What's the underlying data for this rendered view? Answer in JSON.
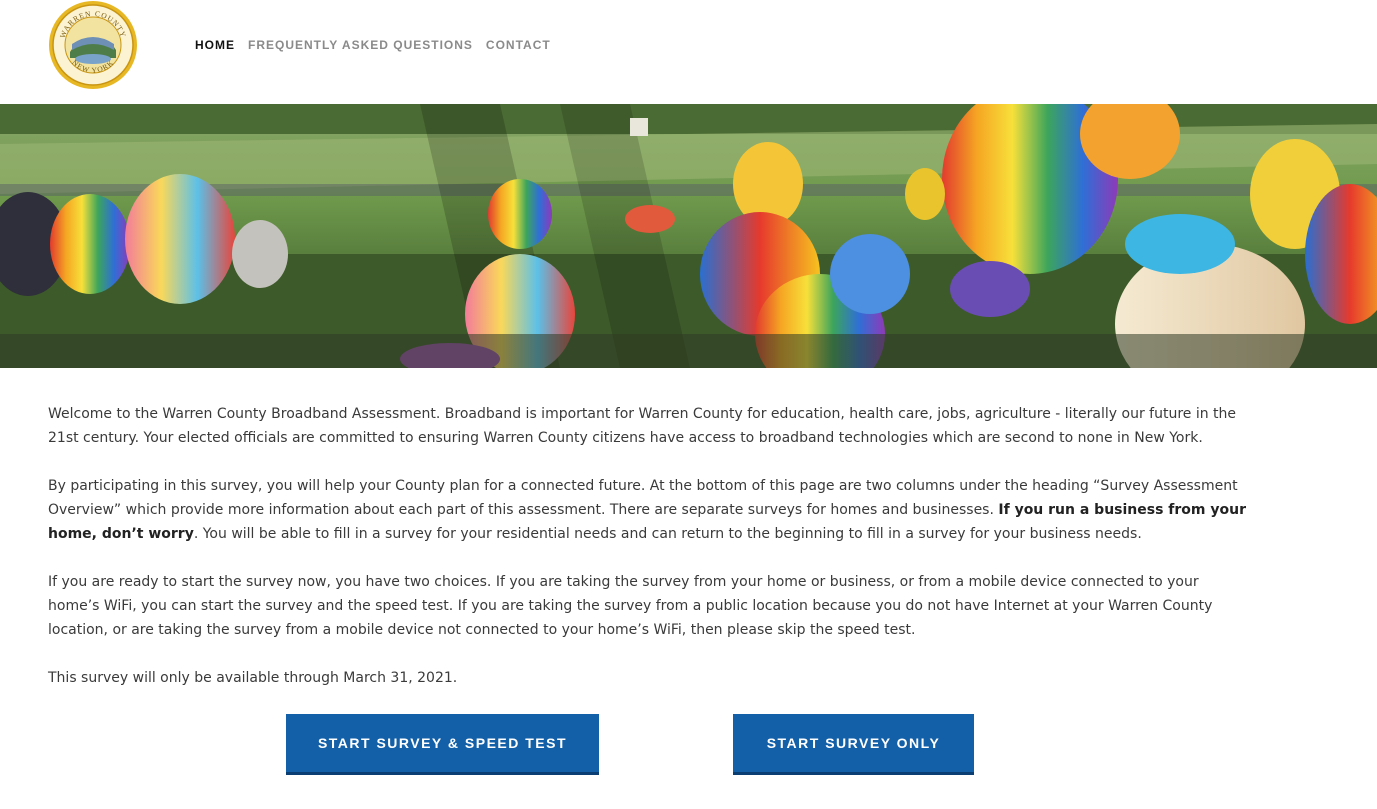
{
  "logo": {
    "alt": "Warren County New York seal",
    "seal_text_top": "WARREN COUNTY",
    "seal_text_bottom": "NEW YORK"
  },
  "nav": {
    "items": [
      {
        "label": "HOME",
        "active": true
      },
      {
        "label": "FREQUENTLY ASKED QUESTIONS",
        "active": false
      },
      {
        "label": "CONTACT",
        "active": false
      }
    ]
  },
  "hero": {
    "alt": "Aerial view of hot air balloons at a festival field"
  },
  "main": {
    "p1": "Welcome to the Warren County Broadband Assessment.  Broadband is important for Warren County for education, health care, jobs, agriculture - literally our future in the 21st century.  Your elected officials are committed to ensuring Warren County citizens have access to broadband technologies which are second to none in New York.",
    "p2_a": "By participating in this survey, you will help your County plan for a connected future.  At the bottom of this page are two columns under the heading “Survey Assessment Overview” which provide more information about each part of this assessment.  There are separate surveys for homes and businesses. ",
    "p2_bold": "If you run a business from your home, don’t worry",
    "p2_b": ". You will be able to fill in a survey for your residential needs and can return to the beginning to fill in a survey for your business needs.",
    "p3": "If you are ready to start the survey now, you have two choices. If you are taking the survey from your home or business, or from a mobile device connected to your home’s WiFi, you can start the survey and the speed test. If you are taking the survey from a public location because you do not have Internet at your Warren County location, or are taking the survey from a mobile device not connected to your home’s WiFi, then please skip the speed test.",
    "p4": "This survey will only be available through March 31, 2021."
  },
  "buttons": {
    "start_speed": "START SURVEY & SPEED TEST",
    "start_only": "START SURVEY ONLY"
  },
  "colors": {
    "button_bg": "#1460a8",
    "nav_active": "#111111",
    "nav_inactive": "#8a8a8a",
    "seal_gold": "#e8b824"
  }
}
